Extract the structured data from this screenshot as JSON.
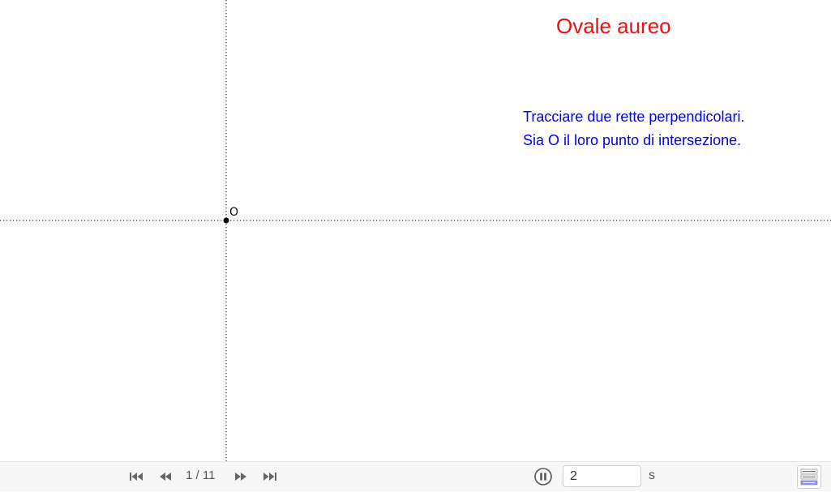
{
  "canvas": {
    "title": "Ovale aureo",
    "instructions": [
      "Tracciare due rette perpendicolari.",
      "Sia O il loro punto di intersezione."
    ],
    "point_label": "O"
  },
  "toolbar": {
    "page_indicator": "1 / 11",
    "speed_value": "2",
    "speed_unit": "s",
    "icons": [
      "skip-to-start-icon",
      "step-back-icon",
      "step-forward-icon",
      "skip-to-end-icon",
      "pause-icon",
      "algebra-view-icon"
    ]
  },
  "colors": {
    "title": "#ee1111",
    "instructions": "#0000ee",
    "lines": "#333333",
    "nav_icons": "#666666"
  }
}
